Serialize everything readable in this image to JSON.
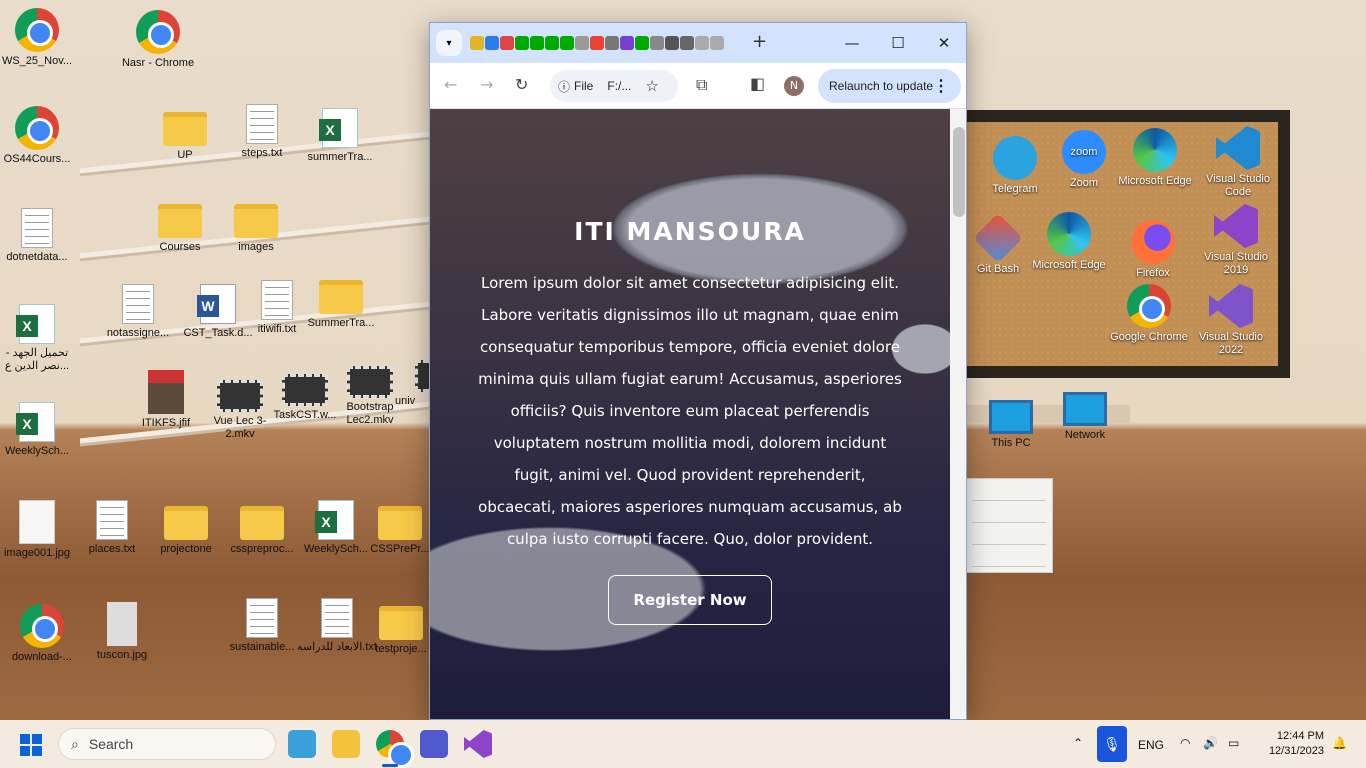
{
  "desktop": {
    "icons": [
      {
        "label": "WS_25_Nov..."
      },
      {
        "label": "Nasr - Chrome"
      },
      {
        "label": "OS44Cours..."
      },
      {
        "label": "UP"
      },
      {
        "label": "steps.txt"
      },
      {
        "label": "summerTra..."
      },
      {
        "label": "Courses"
      },
      {
        "label": "images"
      },
      {
        "label": "dotnetdata..."
      },
      {
        "label": "notassigne..."
      },
      {
        "label": "CST_Task.d..."
      },
      {
        "label": "itiwifi.txt"
      },
      {
        "label": "SummerTra..."
      },
      {
        "label": "تحميل الجهد - نصر الدين ع..."
      },
      {
        "label": "ITIKFS.jfif"
      },
      {
        "label": "Vue Lec 3-2.mkv"
      },
      {
        "label": "TaskCST.w..."
      },
      {
        "label": "Bootstrap Lec2.mkv"
      },
      {
        "label": "WeeklySch..."
      },
      {
        "label": "image001.jpg"
      },
      {
        "label": "places.txt"
      },
      {
        "label": "projectone"
      },
      {
        "label": "csspreproc..."
      },
      {
        "label": "WeeklySch..."
      },
      {
        "label": "CSSPrePr..."
      },
      {
        "label": "download-..."
      },
      {
        "label": "tuscon.jpg"
      },
      {
        "label": "sustainable..."
      },
      {
        "label": "الابعاد للدراسه.txt"
      },
      {
        "label": "testproje..."
      },
      {
        "label": "Telegram"
      },
      {
        "label": "Zoom"
      },
      {
        "label": "Microsoft Edge"
      },
      {
        "label": "Visual Studio Code"
      },
      {
        "label": "Git Bash"
      },
      {
        "label": "Microsoft Edge"
      },
      {
        "label": "Firefox"
      },
      {
        "label": "Visual Studio 2019"
      },
      {
        "label": "Google Chrome"
      },
      {
        "label": "Visual Studio 2022"
      },
      {
        "label": "This PC"
      },
      {
        "label": "Network"
      },
      {
        "label": "univ"
      }
    ]
  },
  "browser": {
    "tab_list_icon": "chevron-down-icon",
    "new_tab": "+",
    "minimize": "—",
    "maximize": "☐",
    "close": "✕",
    "back": "←",
    "forward": "→",
    "reload": "↻",
    "omnibox": {
      "chip_label": "File",
      "url": "F:/..."
    },
    "bookmark": "☆",
    "profile_initial": "N",
    "relaunch_label": "Relaunch to update",
    "menu": "⋮"
  },
  "page": {
    "title": "ITI MANSOURA",
    "paragraph": "Lorem ipsum dolor sit amet consectetur adipisicing elit. Labore veritatis dignissimos illo ut magnam, quae enim consequatur temporibus tempore, officia eveniet dolore minima quis ullam fugiat earum! Accusamus, asperiores officiis? Quis inventore eum placeat perferendis voluptatem nostrum mollitia modi, dolorem incidunt fugit, animi vel. Quod provident reprehenderit, obcaecati, maiores asperiores numquam accusamus, ab culpa iusto corrupti facere. Quo, dolor provident.",
    "cta_label": "Register  Now"
  },
  "taskbar": {
    "search_placeholder": "Search",
    "language": "ENG",
    "time": "12:44 PM",
    "date": "12/31/2023"
  },
  "colors": {
    "accent": "#1a56db",
    "chrome_tabbar": "#d3e3fd",
    "folder": "#f7c948"
  }
}
